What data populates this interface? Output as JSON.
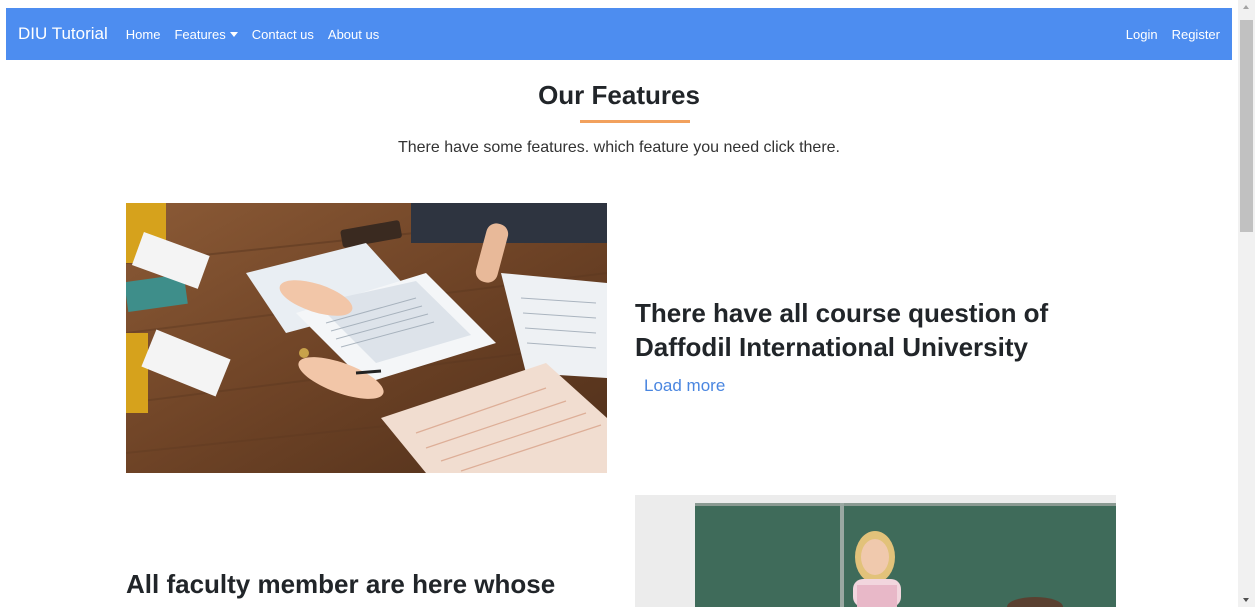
{
  "nav": {
    "brand": "DIU Tutorial",
    "links": [
      "Home",
      "Features",
      "Contact us",
      "About us"
    ],
    "right_links": [
      "Login",
      "Register"
    ],
    "color": "#4d8df0"
  },
  "features_section": {
    "title": "Our Features",
    "subtitle": "There have some features. which feature you need click there.",
    "underline_color": "#f2a15d"
  },
  "features": [
    {
      "heading": "There have all course question of Daffodil International University",
      "link": "Load more",
      "image": "papers-on-desk-photo"
    },
    {
      "heading": "All faculty member are here whose",
      "image": "teacher-at-chalkboard-photo"
    }
  ]
}
